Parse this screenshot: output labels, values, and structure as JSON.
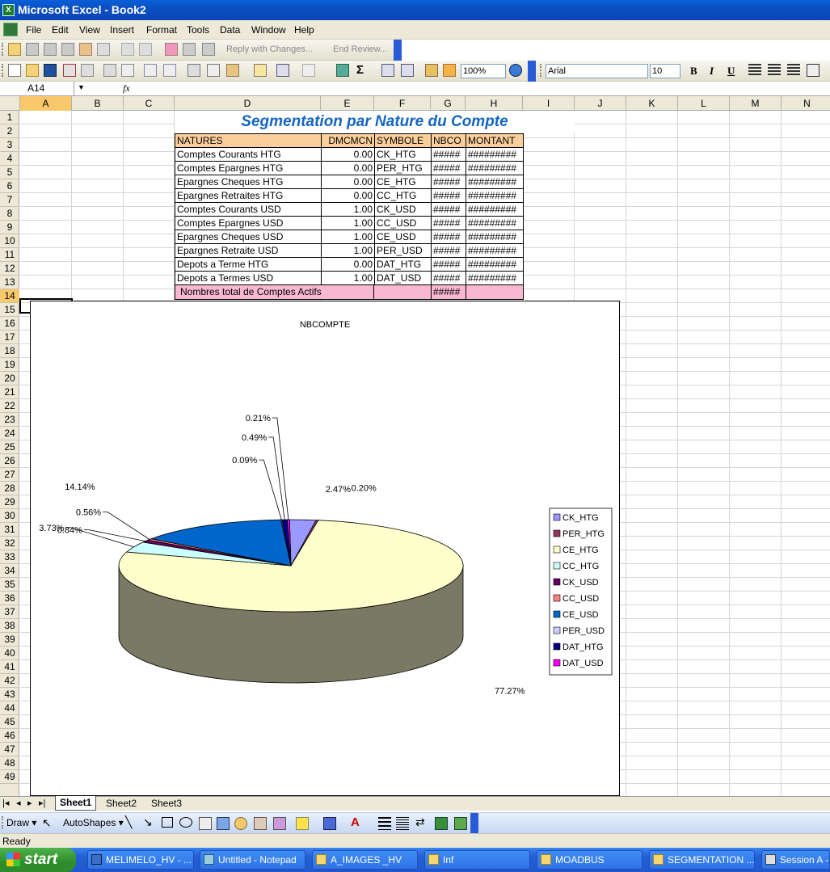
{
  "window": {
    "title": "Microsoft Excel - Book2"
  },
  "menu": [
    "File",
    "Edit",
    "View",
    "Insert",
    "Format",
    "Tools",
    "Data",
    "Window",
    "Help"
  ],
  "toolbar": {
    "reply": "Reply with Changes...",
    "end_review": "End Review...",
    "zoom": "100%",
    "font": "Arial",
    "font_size": "10",
    "bold": "B",
    "italic": "I",
    "underline": "U"
  },
  "formula": {
    "namebox": "A14",
    "fx": "fx"
  },
  "columns": [
    "A",
    "B",
    "C",
    "D",
    "E",
    "F",
    "G",
    "H",
    "I",
    "J",
    "K",
    "L",
    "M",
    "N"
  ],
  "rows": [
    "1",
    "2",
    "3",
    "4",
    "5",
    "6",
    "7",
    "8",
    "9",
    "10",
    "11",
    "12",
    "13",
    "14",
    "15",
    "16",
    "17",
    "18",
    "19",
    "20",
    "21",
    "22",
    "23",
    "24",
    "25",
    "26",
    "27",
    "28",
    "29",
    "30",
    "31",
    "32",
    "33",
    "34",
    "35",
    "36",
    "37",
    "38",
    "39",
    "40",
    "41",
    "42",
    "43",
    "44",
    "45",
    "46",
    "47",
    "48",
    "49"
  ],
  "sheet": {
    "title": "Segmentation  par Nature du Compte",
    "headers": [
      "NATURES",
      "DMCMCN",
      "SYMBOLE",
      "NBCO",
      "MONTANT"
    ],
    "rows": [
      [
        "Comptes Courants HTG",
        "0.00",
        "CK_HTG",
        "#####",
        "#########"
      ],
      [
        "Comptes Epargnes HTG",
        "0.00",
        "PER_HTG",
        "#####",
        "#########"
      ],
      [
        "Epargnes Cheques HTG",
        "0.00",
        "CE_HTG",
        "#####",
        "#########"
      ],
      [
        "Epargnes Retraites HTG",
        "0.00",
        "CC_HTG",
        "#####",
        "#########"
      ],
      [
        "Comptes Courants USD",
        "1.00",
        "CK_USD",
        "#####",
        "#########"
      ],
      [
        "Comptes Epargnes USD",
        "1.00",
        "CC_USD",
        "#####",
        "#########"
      ],
      [
        "Epargnes Cheques  USD",
        "1.00",
        "CE_USD",
        "#####",
        "#########"
      ],
      [
        "Epargnes Retraite USD",
        "1.00",
        "PER_USD",
        "#####",
        "#########"
      ],
      [
        "Depots a Terme HTG",
        "0.00",
        "DAT_HTG",
        "#####",
        "#########"
      ],
      [
        "Depots a Termes USD",
        "1.00",
        "DAT_USD",
        "#####",
        "#########"
      ]
    ],
    "total_label": "Nombres total de Comptes Actifs",
    "total_value": "#####"
  },
  "chart_data": {
    "type": "pie",
    "title": "NBCOMPTE",
    "legend_position": "right",
    "series": [
      {
        "name": "NBCOMPTE",
        "values": [
          2.47,
          0.2,
          77.27,
          3.73,
          0.84,
          0.56,
          14.14,
          0.09,
          0.49,
          0.21
        ]
      }
    ],
    "categories": [
      "CK_HTG",
      "PER_HTG",
      "CE_HTG",
      "CC_HTG",
      "CK_USD",
      "CC_USD",
      "CE_USD",
      "PER_USD",
      "DAT_HTG",
      "DAT_USD"
    ],
    "labels": [
      "2.47%",
      "0.20%",
      "77.27%",
      "3.73%",
      "0.84%",
      "0.56%",
      "14.14%",
      "0.09%",
      "0.49%",
      "0.21%"
    ],
    "colors": [
      "#9999ff",
      "#993366",
      "#ffffcc",
      "#ccffff",
      "#660066",
      "#ff8080",
      "#0066cc",
      "#ccccff",
      "#000080",
      "#ff00ff"
    ]
  },
  "tabs": [
    "Sheet1",
    "Sheet2",
    "Sheet3"
  ],
  "drawbar": {
    "draw": "Draw",
    "autoshapes": "AutoShapes"
  },
  "status": "Ready",
  "taskbar": {
    "start": "start",
    "items": [
      "MELIMELO_HV - ...",
      "Untitled - Notepad",
      "A_IMAGES _HV",
      "Inf",
      "MOADBUS",
      "SEGMENTATION ...",
      "Session A - ["
    ]
  }
}
